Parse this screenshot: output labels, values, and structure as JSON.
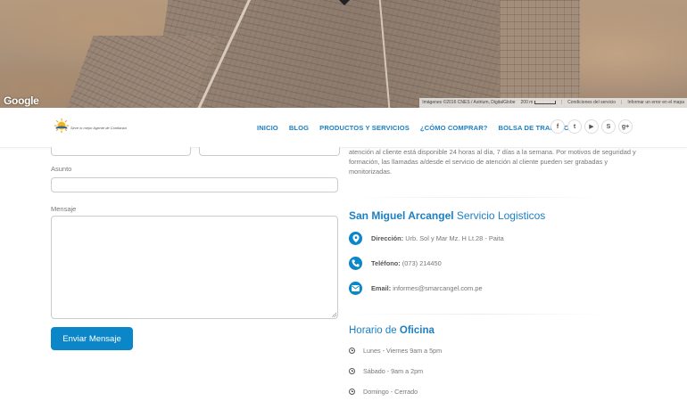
{
  "map": {
    "google_logo": "Google",
    "footer": {
      "imagery": "Imágenes ©2016 CNES / Astrium, DigitalGlobe",
      "scale": "200 m",
      "terms": "Condiciones del servicio",
      "report": "Informar un error en el mapa"
    }
  },
  "nav": {
    "logo_tagline": "Sirve lo mejor Agente de Confianza",
    "links": [
      {
        "label": "INICIO"
      },
      {
        "label": "BLOG"
      },
      {
        "label": "PRODUCTOS Y SERVICIOS"
      },
      {
        "label": "¿CÓMO COMPRAR?"
      },
      {
        "label": "BOLSA DE TRABAJO"
      }
    ],
    "social": [
      {
        "icon": "facebook-icon",
        "glyph": "f"
      },
      {
        "icon": "twitter-icon",
        "glyph": "t"
      },
      {
        "icon": "youtube-icon",
        "glyph": "▶"
      },
      {
        "icon": "skype-icon",
        "glyph": "S"
      },
      {
        "icon": "google-plus-icon",
        "glyph": "g+"
      }
    ]
  },
  "form": {
    "asunto_label": "Asunto",
    "mensaje_label": "Mensaje",
    "submit_label": "Enviar Mensaje"
  },
  "info": {
    "intro": "atención al cliente está disponible 24 horas al día, 7 días a la semana. Por motivos de seguridad y formación, las llamadas a/desde el servicio de atención al cliente pueden ser grabadas y monitorizadas.",
    "company_bold": "San Miguel Arcangel",
    "company_rest": " Servicio Logisticos",
    "address_label": "Dirección:",
    "address_value": " Urb. Sol y Mar Mz. H Lt.28 - Paita",
    "phone_label": "Teléfono:",
    "phone_value": " (073) 214450",
    "email_label": "Email:",
    "email_value": " informes@smarcangel.com.pe"
  },
  "hours": {
    "title_pre": "Horario de ",
    "title_bold": "Oficina",
    "items": [
      {
        "text": "Lunes - Viernes 9am a 5pm"
      },
      {
        "text": "Sábado - 9am a 2pm"
      },
      {
        "text": "Domingo - Cerrado"
      }
    ]
  },
  "colors": {
    "accent": "#1b7fc4",
    "button": "#0a86c9"
  }
}
